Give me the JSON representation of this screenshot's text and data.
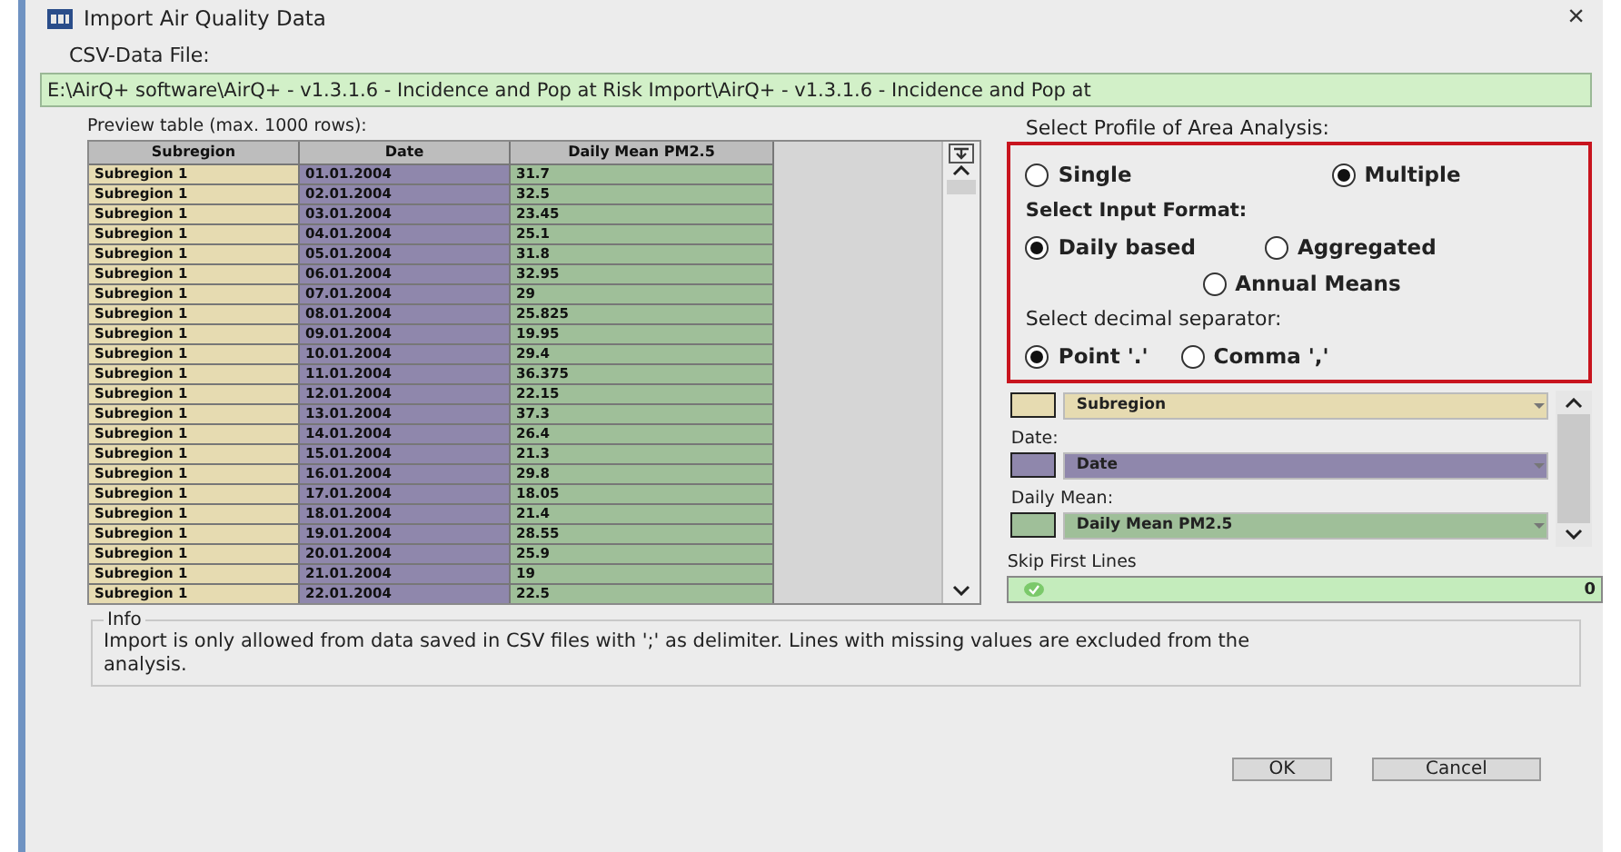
{
  "window": {
    "title": "Import Air Quality Data",
    "close": "×"
  },
  "csv_file": {
    "label": "CSV-Data File:",
    "value": "E:\\AirQ+ software\\AirQ+ - v1.3.1.6 - Incidence and Pop at Risk Import\\AirQ+ - v1.3.1.6 - Incidence and Pop at"
  },
  "preview": {
    "label": "Preview table (max. 1000 rows):",
    "columns": [
      {
        "title": "Subregion",
        "color": "#e6dbb1"
      },
      {
        "title": "Date",
        "color": "#8f87ac"
      },
      {
        "title": "Daily Mean PM2.5",
        "color": "#9fbf99"
      }
    ],
    "rows": [
      [
        "Subregion 1",
        "01.01.2004",
        "31.7"
      ],
      [
        "Subregion 1",
        "02.01.2004",
        "32.5"
      ],
      [
        "Subregion 1",
        "03.01.2004",
        "23.45"
      ],
      [
        "Subregion 1",
        "04.01.2004",
        "25.1"
      ],
      [
        "Subregion 1",
        "05.01.2004",
        "31.8"
      ],
      [
        "Subregion 1",
        "06.01.2004",
        "32.95"
      ],
      [
        "Subregion 1",
        "07.01.2004",
        "29"
      ],
      [
        "Subregion 1",
        "08.01.2004",
        "25.825"
      ],
      [
        "Subregion 1",
        "09.01.2004",
        "19.95"
      ],
      [
        "Subregion 1",
        "10.01.2004",
        "29.4"
      ],
      [
        "Subregion 1",
        "11.01.2004",
        "36.375"
      ],
      [
        "Subregion 1",
        "12.01.2004",
        "22.15"
      ],
      [
        "Subregion 1",
        "13.01.2004",
        "37.3"
      ],
      [
        "Subregion 1",
        "14.01.2004",
        "26.4"
      ],
      [
        "Subregion 1",
        "15.01.2004",
        "21.3"
      ],
      [
        "Subregion 1",
        "16.01.2004",
        "29.8"
      ],
      [
        "Subregion 1",
        "17.01.2004",
        "18.05"
      ],
      [
        "Subregion 1",
        "18.01.2004",
        "21.4"
      ],
      [
        "Subregion 1",
        "19.01.2004",
        "28.55"
      ],
      [
        "Subregion 1",
        "20.01.2004",
        "25.9"
      ],
      [
        "Subregion 1",
        "21.01.2004",
        "19"
      ],
      [
        "Subregion 1",
        "22.01.2004",
        "22.5"
      ]
    ]
  },
  "profile": {
    "title": "Select Profile of Area Analysis:",
    "sections": [
      {
        "options": [
          {
            "label": "Single",
            "selected": false
          },
          {
            "label": "Multiple",
            "selected": true
          }
        ]
      },
      {
        "heading": "Select Input Format:",
        "options": [
          {
            "label": "Daily based",
            "selected": true
          },
          {
            "label": "Aggregated",
            "selected": false
          },
          {
            "label": "Annual Means",
            "selected": false
          }
        ]
      },
      {
        "heading": "Select decimal separator:",
        "options": [
          {
            "label": "Point '.'",
            "selected": true
          },
          {
            "label": "Comma ','",
            "selected": false
          }
        ]
      }
    ]
  },
  "mappings": [
    {
      "dropdown": {
        "value": "Subregion",
        "color": "#e6dbb1"
      }
    },
    {
      "label": "Date:",
      "dropdown": {
        "value": "Date",
        "color": "#8f87ac"
      }
    },
    {
      "label": "Daily Mean:",
      "dropdown": {
        "value": "Daily Mean PM2.5",
        "color": "#9fbf99"
      }
    }
  ],
  "skip_first_lines": {
    "label": "Skip First Lines",
    "value": "0"
  },
  "info": {
    "title": "Info",
    "text": "Import is only allowed from data saved in CSV files with ';' as delimiter. Lines with missing values are excluded from the analysis."
  },
  "buttons": [
    "OK",
    "Cancel"
  ]
}
